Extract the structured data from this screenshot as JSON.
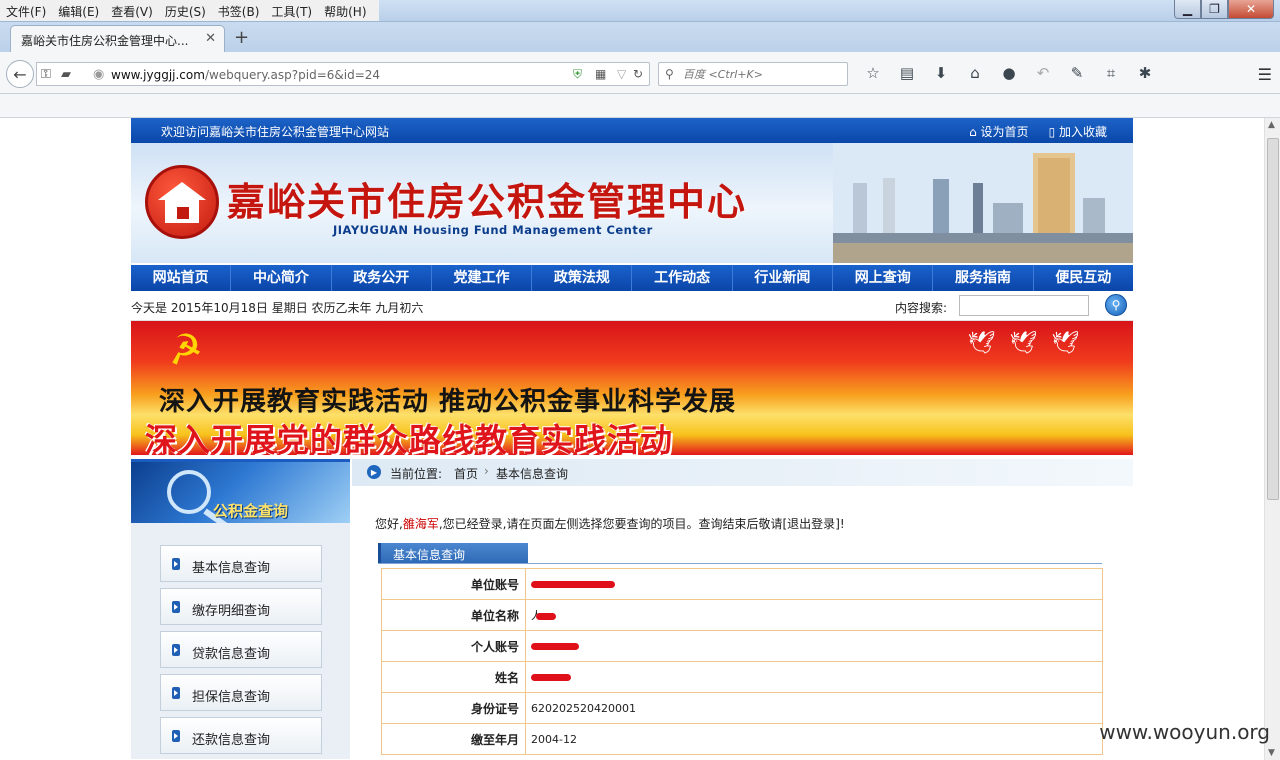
{
  "browser": {
    "menus": [
      "文件(F)",
      "编辑(E)",
      "查看(V)",
      "历史(S)",
      "书签(B)",
      "工具(T)",
      "帮助(H)"
    ],
    "tab_title": "嘉峪关市住房公积金管理中心...",
    "url_host": "www.jyggjj.com",
    "url_path": "/webquery.asp?pid=6&id=24",
    "search_placeholder": "百度 <Ctrl+K>"
  },
  "site": {
    "welcome": "欢迎访问嘉峪关市住房公积金管理中心网站",
    "set_home": "设为首页",
    "add_favorite": "加入收藏",
    "title_cn": "嘉峪关市住房公积金管理中心",
    "title_en": "JIAYUGUAN Housing Fund Management Center",
    "nav": [
      "网站首页",
      "中心简介",
      "政务公开",
      "党建工作",
      "政策法规",
      "工作动态",
      "行业新闻",
      "网上查询",
      "服务指南",
      "便民互动"
    ],
    "date_text": "今天是  2015年10月18日  星期日  农历乙未年  九月初六",
    "search_label": "内容搜索:",
    "banner_line1": "深入开展教育实践活动     推动公积金事业科学发展",
    "banner_line2": "深入开展党的群众路线教育实践活动",
    "side_title": "公积金查询",
    "side_menu": [
      "基本信息查询",
      "缴存明细查询",
      "贷款信息查询",
      "担保信息查询",
      "还款信息查询"
    ],
    "breadcrumb": {
      "label": "当前位置:",
      "home": "首页",
      "current": "基本信息查询"
    },
    "notice": {
      "prefix": "您好,",
      "user": "雒海军",
      "suffix": ",您已经登录,请在页面左侧选择您要查询的项目。查询结束后敬请[",
      "logout": "退出登录",
      "end": "]!"
    },
    "section_title": "基本信息查询",
    "rows": [
      {
        "label": "单位账号",
        "value": ""
      },
      {
        "label": "单位名称",
        "value": "人"
      },
      {
        "label": "个人账号",
        "value": ""
      },
      {
        "label": "姓名",
        "value": ""
      },
      {
        "label": "身份证号",
        "value": "620202520420001"
      },
      {
        "label": "缴至年月",
        "value": "2004-12"
      }
    ]
  },
  "watermark": "www.wooyun.org"
}
